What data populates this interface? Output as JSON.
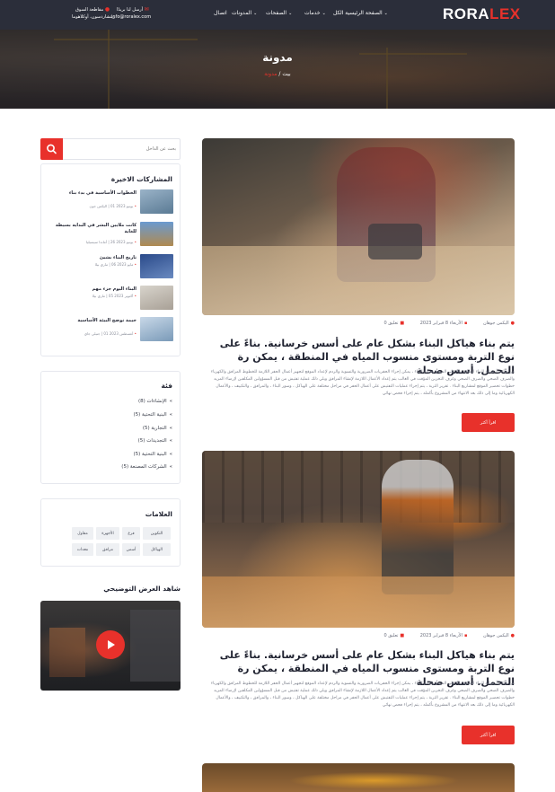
{
  "header": {
    "logo_main": "RORA",
    "logo_accent": "LEX",
    "nav": [
      "الصفحة الرئيسية الكل",
      "خدمات",
      "الصفحات",
      "المدونات",
      "اتصال"
    ],
    "contact_address_line1": "مقاطعة السوق",
    "contact_address_line2": "ريتشاردسون، أوكلاهوما",
    "contact_email_line1": "أرسل لنا بريدًا",
    "contact_email_line2": "info@roralex.com"
  },
  "banner": {
    "title": "مدونة",
    "crumb_home": "بيت",
    "crumb_sep": "/",
    "crumb_current": "مدونة"
  },
  "posts": [
    {
      "author": "اليكس جوهان",
      "date": "الأربعاء 8 فبراير 2023",
      "comments": "تعليق 0",
      "title": "يتم بناء هياكل البناء بشكل عام على أسس خرسانية. بناءً على نوع التربة ومستوى منسوب المياه في المنطقة ، يمكن رة التحمل. أسس ضحلة",
      "excerpt": "من هنا تبدأ عملية البناء الفعلية بناءً على الموقع وخطة البناء ، يمكن إجراء الحفريات الضرورية والتسوية والردم لإعداد الموقع لتجهيز أعمال الحفر اللازمة للخطوط المرافق والكهرباء والصرف الصحي والصرف الصحي وغرف التخزين المؤقت في الغالب يتم إعداد الأعمال اللازمة لإنشاء المرافق ويلي ذلك عملية تفتيش من قبل المسؤولين المكلفين لإرضاء المزيد خطوات تحضير الموقع لمشاريع البناء . تقرير التربة ، يتم إجراء عمليات التفتيش على أعمال الحفر في مراحل مختلفة على الهياكل ، وسور البناء ، والمرافق ، والتكييف ، والأعمال الكهربائية وما إلى ذلك بعد الانتهاء من المشروع بأكمله ، يتم إجراء فحص نهائي",
      "read_more": "اقرأ أكثر"
    },
    {
      "author": "اليكس جوهان",
      "date": "الأربعاء 8 فبراير 2023",
      "comments": "تعليق 0",
      "title": "يتم بناء هياكل البناء بشكل عام على أسس خرسانية. بناءً على نوع التربة ومستوى منسوب المياه في المنطقة ، يمكن رة التحمل. أسس ضحلة",
      "excerpt": "من هنا تبدأ عملية البناء الفعلية بناءً على الموقع وخطة البناء ، يمكن إجراء الحفريات الضرورية والتسوية والردم لإعداد الموقع لتجهيز أعمال الحفر اللازمة للخطوط المرافق والكهرباء والصرف الصحي والصرف الصحي وغرف التخزين المؤقت في الغالب يتم إعداد الأعمال اللازمة لإنشاء المرافق ويلي ذلك عملية تفتيش من قبل المسؤولين المكلفين لإرضاء المزيد خطوات تحضير الموقع لمشاريع البناء . تقرير التربة ، يتم إجراء عمليات التفتيش على أعمال الحفر في مراحل مختلفة على الهياكل ، وسور البناء ، والمرافق ، والتكييف ، والأعمال الكهربائية وما إلى ذلك بعد الانتهاء من المشروع بأكمله ، يتم إجراء فحص نهائي",
      "read_more": "اقرأ أكثر"
    }
  ],
  "sidebar": {
    "search_placeholder": "بحث عن الداخل",
    "recent_title": "المشاركات الاخيرة",
    "recent": [
      {
        "title": "الخطوات الأساسية في بدء بناء",
        "date": "يونيو 2023 01",
        "author": "اليكس جون"
      },
      {
        "title": "كانت ملايين البشر في البداية بسيطة للغاية",
        "date": "يونيو 2023 26",
        "author": "أماندا سيسيليا"
      },
      {
        "title": "تاريخ البناء بشيئ",
        "date": "مايو 2023 06",
        "author": "ماري بيلا"
      },
      {
        "title": "البناء اليوم جزء مهم",
        "date": "أكتوبر 2023 05",
        "author": "ماري بيلا"
      },
      {
        "title": "خيمة توضح البيئة الأساسية",
        "date": "أغسطس 2023 01",
        "author": "جنيلي جاي"
      }
    ],
    "categories_title": "فئة",
    "categories": [
      "الإنشاءات (8)",
      "البنية التحتية (5)",
      "التجارية (5)",
      "التجديدات (5)",
      "البنية التحتية (5)",
      "الشركات المصنعة (5)"
    ],
    "tags_title": "العلامات",
    "tags": [
      "التكوين",
      "فرع",
      "الأجهزة",
      "مقاول",
      "الهياكل",
      "أسس",
      "مرافق",
      "معدات"
    ],
    "video_title": "شاهد العرض التوضيحي"
  },
  "colors": {
    "accent": "#e8312b",
    "header_bg": "#2b2e3a",
    "title": "#1f2230"
  },
  "icons": [
    "search-icon",
    "location-icon",
    "mail-icon",
    "user-icon",
    "calendar-icon",
    "comment-icon",
    "clock-icon",
    "chevron-icon",
    "play-icon"
  ]
}
